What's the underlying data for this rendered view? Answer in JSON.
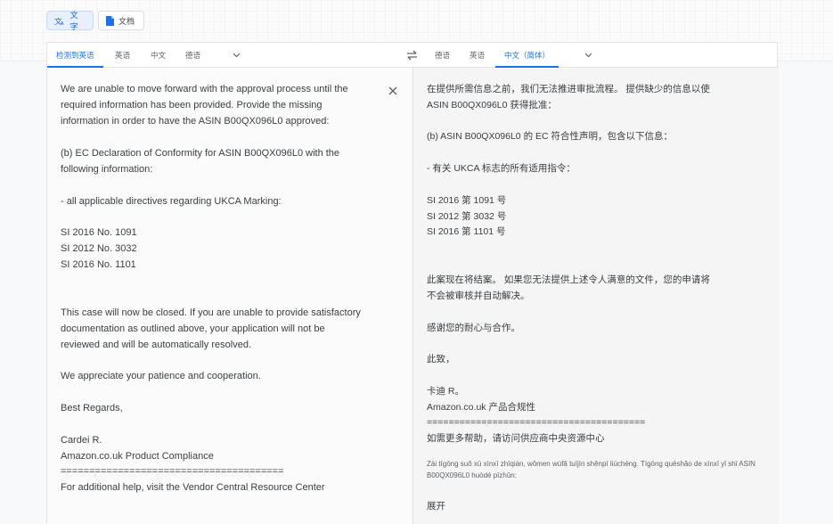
{
  "modes": {
    "text_label": "文字",
    "docs_label": "文档"
  },
  "source_tabs": [
    "检测到英语",
    "英语",
    "中文",
    "德语"
  ],
  "target_tabs": [
    "德语",
    "英语",
    "中文（简体）"
  ],
  "source_lines": [
    "We are unable to move forward with the approval process until the",
    "required information has been provided. Provide the missing",
    "information in order to have the ASIN B00QX096L0   approved:",
    "(b) EC Declaration of Conformity for ASIN B00QX096L0  with the",
    "following information:",
    "- all applicable directives regarding UKCA Marking:",
    "SI 2016 No. 1091",
    "SI 2012 No. 3032",
    "SI 2016 No. 1101",
    "This case will now be closed. If you are unable to provide satisfactory",
    "documentation as outlined above, your application will not be",
    "reviewed and will be automatically resolved.",
    "We appreciate your patience and cooperation.",
    "Best Regards,",
    "Cardei R.",
    "Amazon.co.uk Product Compliance",
    "=======================================",
    "For additional help, visit the Vendor Central Resource Center"
  ],
  "target_lines": [
    "在提供所需信息之前，我们无法推进审批流程。 提供缺少的信息以使",
    "ASIN B00QX096L0 获得批准：",
    "(b) ASIN B00QX096L0 的 EC 符合性声明，包含以下信息：",
    "- 有关 UKCA 标志的所有适用指令：",
    "SI 2016 第 1091 号",
    "SI 2012 第 3032 号",
    "SI 2016 第 1101 号",
    "此案现在将结案。 如果您无法提供上述令人满意的文件，您的申请将",
    "不会被审核并自动解决。",
    "感谢您的耐心与合作。",
    "此致，",
    "卡迪 R。",
    "Amazon.co.uk 产品合规性",
    "========================================",
    "如需更多帮助，请访问供应商中央资源中心",
    "展开"
  ],
  "romanization": "Zài tígōng suǒ xū xìnxī zhīqián, wǒmen wúfǎ tuījìn shěnpī liúchéng. Tígōng quēshǎo de xìnxī yǐ shǐ ASIN B00QX096L0 huòdé pīzhǔn:",
  "colors": {
    "accent": "#1a73e8",
    "text": "#3c4043",
    "muted": "#5f6368"
  },
  "icons": [
    "translate-icon",
    "document-icon",
    "chevron-down-icon",
    "swap-icon",
    "close-icon"
  ]
}
